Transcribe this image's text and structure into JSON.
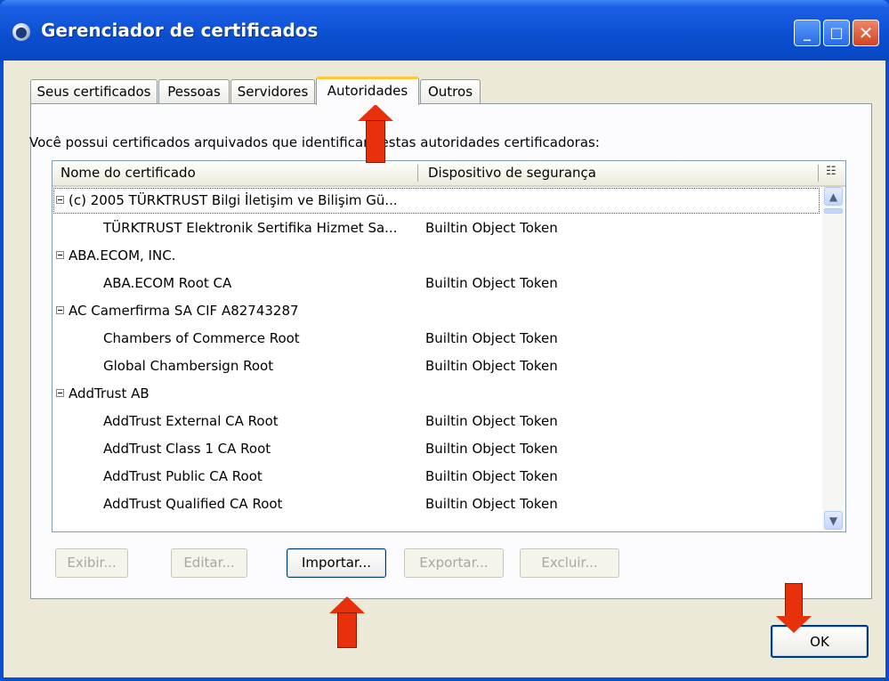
{
  "window": {
    "title": "Gerenciador de certificados",
    "min_label": "_",
    "max_label": "□",
    "close_label": "✕"
  },
  "tabs": [
    {
      "label": "Seus certificados",
      "active": false
    },
    {
      "label": "Pessoas",
      "active": false
    },
    {
      "label": "Servidores",
      "active": false
    },
    {
      "label": "Autoridades",
      "active": true
    },
    {
      "label": "Outros",
      "active": false
    }
  ],
  "panel": {
    "info": "Você possui certificados arquivados que identificam estas autoridades certificadoras:"
  },
  "tree": {
    "columns": [
      "Nome do certificado",
      "Dispositivo de segurança"
    ],
    "rows": [
      {
        "name": "(c) 2005 TÜRKTRUST Bilgi İletişim ve Bilişim Gü...",
        "device": "",
        "group": true
      },
      {
        "name": "TÜRKTRUST Elektronik Sertifika Hizmet Sa...",
        "device": "Builtin Object Token",
        "group": false
      },
      {
        "name": "ABA.ECOM, INC.",
        "device": "",
        "group": true
      },
      {
        "name": "ABA.ECOM Root CA",
        "device": "Builtin Object Token",
        "group": false
      },
      {
        "name": "AC Camerfirma SA CIF A82743287",
        "device": "",
        "group": true
      },
      {
        "name": "Chambers of Commerce Root",
        "device": "Builtin Object Token",
        "group": false
      },
      {
        "name": "Global Chambersign Root",
        "device": "Builtin Object Token",
        "group": false
      },
      {
        "name": "AddTrust AB",
        "device": "",
        "group": true
      },
      {
        "name": "AddTrust External CA Root",
        "device": "Builtin Object Token",
        "group": false
      },
      {
        "name": "AddTrust Class 1 CA Root",
        "device": "Builtin Object Token",
        "group": false
      },
      {
        "name": "AddTrust Public CA Root",
        "device": "Builtin Object Token",
        "group": false
      },
      {
        "name": "AddTrust Qualified CA Root",
        "device": "Builtin Object Token",
        "group": false
      }
    ]
  },
  "buttons": {
    "view": "Exibir...",
    "edit": "Editar...",
    "import": "Importar...",
    "export": "Exportar...",
    "delete": "Excluir...",
    "ok": "OK"
  },
  "colors": {
    "title_bar": "#0a4fd0",
    "dialog_bg": "#ece9d8",
    "annotation_arrow": "#e8300a",
    "active_tab_highlight": "#ffc83c"
  }
}
